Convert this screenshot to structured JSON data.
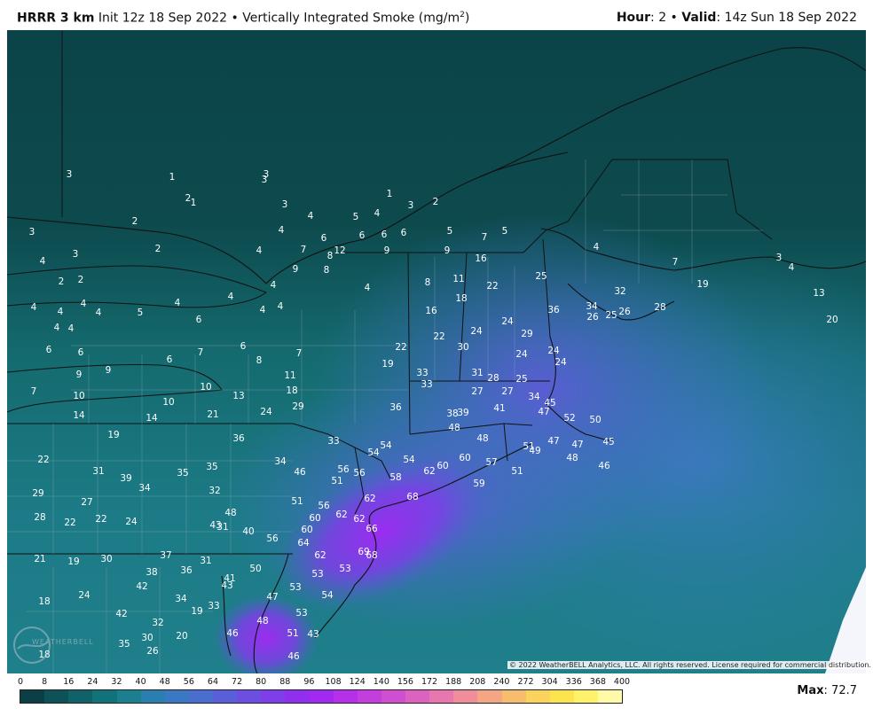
{
  "header": {
    "model": "HRRR 3 km",
    "init_text": " Init 12z 18 Sep 2022 • Vertically Integrated Smoke (mg/m",
    "superscript": "2",
    "close_paren": ")",
    "hour_label": "Hour",
    "hour_value": ": 2 • ",
    "valid_label": "Valid",
    "valid_value": ": 14z Sun 18 Sep 2022"
  },
  "copyright": "© 2022 WeatherBELL Analytics, LLC. All rights reserved. License required for commercial distribution.",
  "logo_text": "WEATHERBELL",
  "colorbar": {
    "ticks": [
      "0",
      "8",
      "16",
      "24",
      "32",
      "40",
      "48",
      "56",
      "64",
      "72",
      "80",
      "88",
      "96",
      "108",
      "124",
      "140",
      "156",
      "172",
      "188",
      "208",
      "240",
      "272",
      "304",
      "336",
      "368",
      "400"
    ],
    "colors": [
      "#0b3f45",
      "#0e5157",
      "#106168",
      "#12727a",
      "#1b7f8f",
      "#2a7fb0",
      "#3a78c4",
      "#4a6dd0",
      "#5a5ed8",
      "#6c4fe0",
      "#7e3ee8",
      "#9030ee",
      "#a22af0",
      "#b630ea",
      "#c43edd",
      "#d04fd0",
      "#dc62c0",
      "#e777ae",
      "#ef8d9a",
      "#f4a584",
      "#f7bd6e",
      "#f9d35c",
      "#fbe44e",
      "#fdf26a",
      "#fffaa8"
    ],
    "max_label": "Max",
    "max_value": ": 72.7"
  },
  "map_labels": [
    [
      "3",
      78,
      196
    ],
    [
      "1",
      194,
      199
    ],
    [
      "3",
      300,
      196
    ],
    [
      "3",
      298,
      202
    ],
    [
      "2",
      212,
      223
    ],
    [
      "1",
      218,
      228
    ],
    [
      "3",
      321,
      230
    ],
    [
      "1",
      439,
      218
    ],
    [
      "3",
      463,
      231
    ],
    [
      "2",
      491,
      227
    ],
    [
      "2",
      152,
      249
    ],
    [
      "4",
      350,
      243
    ],
    [
      "5",
      401,
      244
    ],
    [
      "4",
      425,
      240
    ],
    [
      "3",
      36,
      261
    ],
    [
      "2",
      178,
      280
    ],
    [
      "4",
      317,
      259
    ],
    [
      "6",
      365,
      268
    ],
    [
      "6",
      408,
      265
    ],
    [
      "6",
      433,
      264
    ],
    [
      "6",
      455,
      262
    ],
    [
      "5",
      507,
      260
    ],
    [
      "7",
      546,
      267
    ],
    [
      "5",
      569,
      260
    ],
    [
      "4",
      48,
      294
    ],
    [
      "3",
      85,
      286
    ],
    [
      "4",
      292,
      282
    ],
    [
      "7",
      342,
      281
    ],
    [
      "12",
      383,
      282
    ],
    [
      "9",
      436,
      282
    ],
    [
      "9",
      504,
      282
    ],
    [
      "8",
      372,
      288
    ],
    [
      "16",
      542,
      291
    ],
    [
      "4",
      672,
      278
    ],
    [
      "7",
      761,
      295
    ],
    [
      "3",
      878,
      290
    ],
    [
      "4",
      892,
      301
    ],
    [
      "2",
      69,
      317
    ],
    [
      "2",
      91,
      315
    ],
    [
      "9",
      333,
      303
    ],
    [
      "8",
      368,
      304
    ],
    [
      "25",
      610,
      311
    ],
    [
      "8",
      482,
      318
    ],
    [
      "11",
      517,
      314
    ],
    [
      "22",
      555,
      322
    ],
    [
      "19",
      792,
      320
    ],
    [
      "13",
      923,
      330
    ],
    [
      "4",
      38,
      346
    ],
    [
      "4",
      68,
      351
    ],
    [
      "4",
      94,
      342
    ],
    [
      "4",
      111,
      352
    ],
    [
      "5",
      158,
      352
    ],
    [
      "4",
      200,
      341
    ],
    [
      "4",
      260,
      334
    ],
    [
      "4",
      308,
      321
    ],
    [
      "4",
      414,
      324
    ],
    [
      "18",
      520,
      336
    ],
    [
      "32",
      699,
      328
    ],
    [
      "16",
      486,
      350
    ],
    [
      "6",
      224,
      360
    ],
    [
      "4",
      296,
      349
    ],
    [
      "4",
      316,
      345
    ],
    [
      "36",
      624,
      349
    ],
    [
      "34",
      667,
      345
    ],
    [
      "26",
      668,
      357
    ],
    [
      "25",
      689,
      355
    ],
    [
      "26",
      704,
      351
    ],
    [
      "28",
      744,
      346
    ],
    [
      "4",
      64,
      369
    ],
    [
      "4",
      80,
      370
    ],
    [
      "24",
      572,
      362
    ],
    [
      "22",
      495,
      379
    ],
    [
      "24",
      537,
      373
    ],
    [
      "29",
      594,
      376
    ],
    [
      "20",
      938,
      360
    ],
    [
      "6",
      55,
      394
    ],
    [
      "6",
      91,
      397
    ],
    [
      "6",
      274,
      390
    ],
    [
      "7",
      226,
      397
    ],
    [
      "8",
      292,
      406
    ],
    [
      "7",
      337,
      398
    ],
    [
      "22",
      452,
      391
    ],
    [
      "30",
      522,
      391
    ],
    [
      "24",
      588,
      399
    ],
    [
      "24",
      624,
      395
    ],
    [
      "6",
      191,
      405
    ],
    [
      "24",
      632,
      408
    ],
    [
      "9",
      122,
      417
    ],
    [
      "9",
      89,
      422
    ],
    [
      "19",
      437,
      410
    ],
    [
      "11",
      327,
      423
    ],
    [
      "33",
      476,
      420
    ],
    [
      "31",
      538,
      420
    ],
    [
      "28",
      556,
      426
    ],
    [
      "25",
      588,
      427
    ],
    [
      "10",
      232,
      436
    ],
    [
      "33",
      481,
      433
    ],
    [
      "27",
      538,
      441
    ],
    [
      "27",
      572,
      441
    ],
    [
      "34",
      602,
      447
    ],
    [
      "7",
      38,
      441
    ],
    [
      "10",
      89,
      446
    ],
    [
      "18",
      329,
      440
    ],
    [
      "13",
      269,
      446
    ],
    [
      "10",
      190,
      453
    ],
    [
      "29",
      336,
      458
    ],
    [
      "36",
      446,
      459
    ],
    [
      "45",
      620,
      454
    ],
    [
      "47",
      613,
      464
    ],
    [
      "41",
      563,
      460
    ],
    [
      "38",
      510,
      466
    ],
    [
      "39",
      522,
      465
    ],
    [
      "52",
      642,
      471
    ],
    [
      "50",
      671,
      473
    ],
    [
      "14",
      89,
      468
    ],
    [
      "14",
      171,
      471
    ],
    [
      "21",
      240,
      467
    ],
    [
      "24",
      300,
      464
    ],
    [
      "48",
      512,
      482
    ],
    [
      "19",
      128,
      490
    ],
    [
      "36",
      269,
      494
    ],
    [
      "33",
      376,
      497
    ],
    [
      "54",
      435,
      502
    ],
    [
      "48",
      544,
      494
    ],
    [
      "47",
      624,
      497
    ],
    [
      "47",
      651,
      501
    ],
    [
      "45",
      686,
      498
    ],
    [
      "51",
      596,
      503
    ],
    [
      "49",
      603,
      508
    ],
    [
      "54",
      421,
      510
    ],
    [
      "48",
      645,
      516
    ],
    [
      "46",
      681,
      525
    ],
    [
      "22",
      49,
      518
    ],
    [
      "34",
      316,
      520
    ],
    [
      "46",
      338,
      532
    ],
    [
      "56",
      387,
      529
    ],
    [
      "56",
      405,
      533
    ],
    [
      "54",
      461,
      518
    ],
    [
      "62",
      484,
      531
    ],
    [
      "60",
      499,
      525
    ],
    [
      "60",
      524,
      516
    ],
    [
      "57",
      554,
      521
    ],
    [
      "51",
      583,
      531
    ],
    [
      "35",
      239,
      526
    ],
    [
      "31",
      111,
      531
    ],
    [
      "39",
      142,
      539
    ],
    [
      "35",
      206,
      533
    ],
    [
      "58",
      446,
      538
    ],
    [
      "51",
      380,
      542
    ],
    [
      "59",
      540,
      545
    ],
    [
      "34",
      163,
      550
    ],
    [
      "32",
      242,
      553
    ],
    [
      "29",
      43,
      556
    ],
    [
      "27",
      98,
      566
    ],
    [
      "68",
      465,
      560
    ],
    [
      "62",
      417,
      562
    ],
    [
      "51",
      335,
      565
    ],
    [
      "56",
      365,
      570
    ],
    [
      "62",
      385,
      580
    ],
    [
      "62",
      405,
      585
    ],
    [
      "48",
      260,
      578
    ],
    [
      "28",
      45,
      583
    ],
    [
      "22",
      79,
      589
    ],
    [
      "22",
      114,
      585
    ],
    [
      "24",
      148,
      588
    ],
    [
      "60",
      355,
      584
    ],
    [
      "43",
      243,
      592
    ],
    [
      "31",
      251,
      594
    ],
    [
      "40",
      280,
      599
    ],
    [
      "66",
      419,
      596
    ],
    [
      "60",
      346,
      597
    ],
    [
      "56",
      307,
      607
    ],
    [
      "64",
      342,
      612
    ],
    [
      "69",
      410,
      622
    ],
    [
      "68",
      419,
      626
    ],
    [
      "62",
      361,
      626
    ],
    [
      "37",
      187,
      626
    ],
    [
      "31",
      232,
      632
    ],
    [
      "21",
      45,
      630
    ],
    [
      "19",
      83,
      633
    ],
    [
      "30",
      120,
      630
    ],
    [
      "50",
      288,
      641
    ],
    [
      "53",
      389,
      641
    ],
    [
      "53",
      358,
      647
    ],
    [
      "38",
      171,
      645
    ],
    [
      "36",
      210,
      643
    ],
    [
      "41",
      259,
      652
    ],
    [
      "43",
      256,
      660
    ],
    [
      "42",
      160,
      661
    ],
    [
      "53",
      333,
      662
    ],
    [
      "24",
      95,
      671
    ],
    [
      "34",
      204,
      675
    ],
    [
      "47",
      307,
      673
    ],
    [
      "54",
      369,
      671
    ],
    [
      "18",
      50,
      678
    ],
    [
      "33",
      241,
      683
    ],
    [
      "19",
      222,
      689
    ],
    [
      "53",
      340,
      691
    ],
    [
      "42",
      137,
      692
    ],
    [
      "48",
      296,
      700
    ],
    [
      "32",
      178,
      702
    ],
    [
      "20",
      205,
      717
    ],
    [
      "46",
      262,
      714
    ],
    [
      "51",
      330,
      714
    ],
    [
      "43",
      353,
      715
    ],
    [
      "35",
      140,
      726
    ],
    [
      "30",
      166,
      719
    ],
    [
      "26",
      172,
      734
    ],
    [
      "46",
      331,
      740
    ],
    [
      "18",
      50,
      738
    ]
  ]
}
